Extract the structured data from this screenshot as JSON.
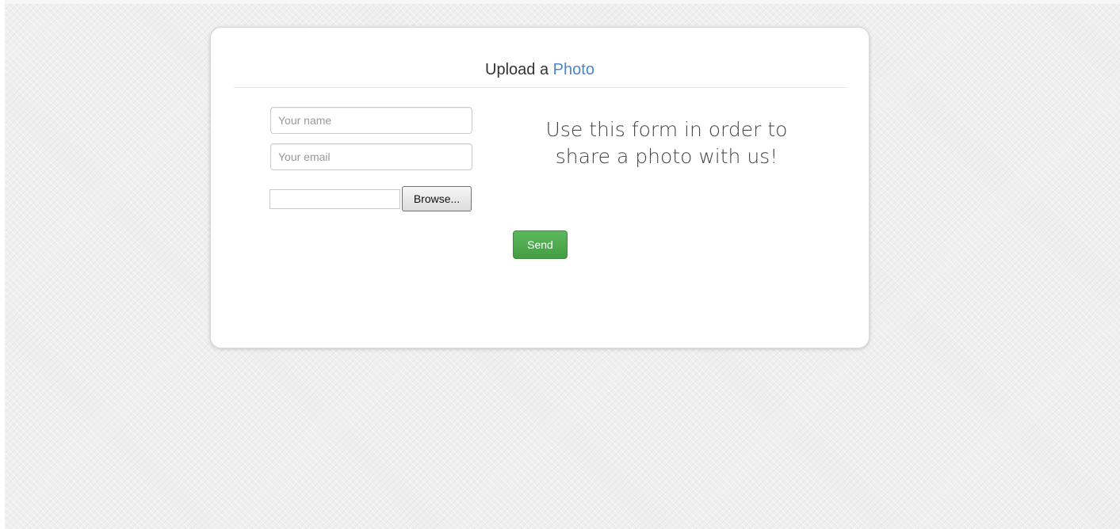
{
  "form": {
    "title_prefix": "Upload a",
    "title_accent": "Photo",
    "name_placeholder": "Your name",
    "email_placeholder": "Your email",
    "file_value": "",
    "browse_label": "Browse...",
    "tagline_line1": "Use this form in order to",
    "tagline_line2": "share a photo with us!",
    "send_label": "Send"
  },
  "colors": {
    "accent": "#4a86c8",
    "send_button": "#5cb85c",
    "background": "#efefef"
  }
}
